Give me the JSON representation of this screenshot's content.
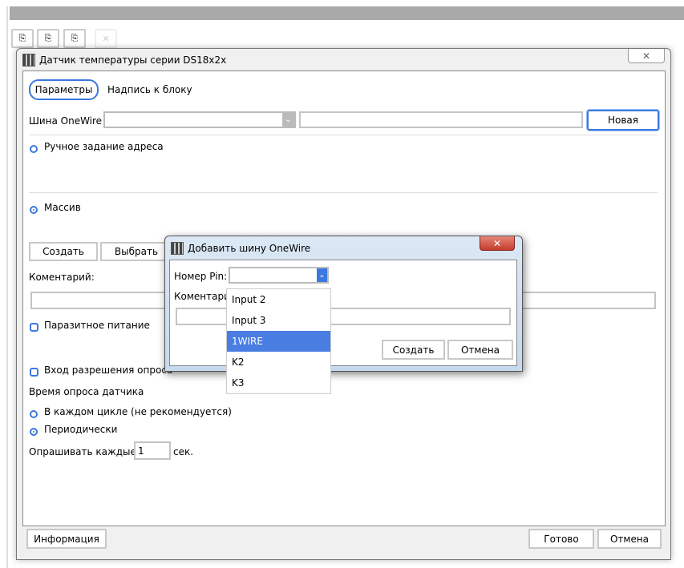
{
  "main_dialog": {
    "title": "Датчик температуры серии DS18x2x",
    "tabs": [
      {
        "label": "Параметры"
      },
      {
        "label": "Надпись к блоку"
      }
    ],
    "bus_label": "Шина OneWire",
    "new_button": "Новая",
    "manual_address": "Ручное задание адреса",
    "array": "Массив",
    "create_button": "Создать",
    "select_button": "Выбрать",
    "comment_label": "Коментарий:",
    "parasitic_power": "Паразитное питание",
    "poll_enable": "Вход разрешения опроса",
    "poll_time_label": "Время опроса датчика",
    "every_cycle": "В каждом цикле (не рекомендуется)",
    "periodic": "Периодически",
    "poll_every_label": "Опрашивать каждые",
    "poll_every_value": "1",
    "poll_every_unit": "сек.",
    "info_button": "Информация",
    "done_button": "Готово",
    "cancel_button": "Отмена"
  },
  "sub_dialog": {
    "title": "Добавить шину OneWire",
    "pin_label": "Номер Pin:",
    "comment_label": "Коментарий:",
    "create_button": "Создать",
    "cancel_button": "Отмена",
    "options": [
      {
        "label": "Input 2"
      },
      {
        "label": "Input 3"
      },
      {
        "label": "1WIRE"
      },
      {
        "label": "K2"
      },
      {
        "label": "K3"
      }
    ]
  },
  "colors": {
    "accent": "#3b78e0",
    "selection": "#4a7de2"
  }
}
